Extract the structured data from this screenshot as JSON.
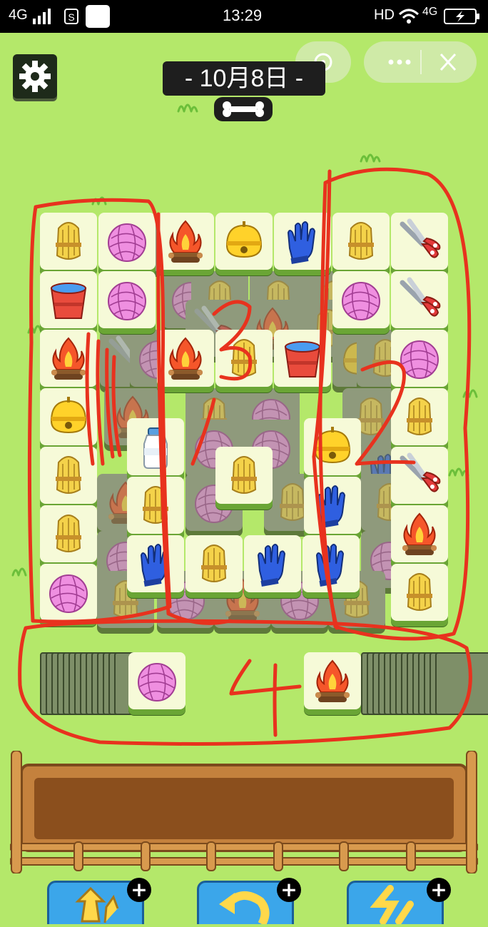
{
  "status_bar": {
    "network_left": "4G",
    "time": "13:29",
    "hd": "HD",
    "network_right": "4G"
  },
  "header": {
    "date": "- 10月8日 -"
  },
  "annotations": {
    "label_1": "1",
    "label_2a": "2",
    "label_3": "3",
    "label_2b": "2",
    "label_4": "4"
  },
  "board": {
    "top_layer": [
      {
        "icon": "wheat-icon"
      },
      {
        "icon": "yarn-icon"
      },
      {
        "icon": "campfire-icon"
      },
      {
        "icon": "bell-icon"
      },
      {
        "icon": "glove-icon"
      },
      {
        "icon": "wheat-icon"
      },
      {
        "icon": "scissors-icon"
      },
      {
        "icon": "bucket-icon"
      },
      {
        "icon": "yarn-icon"
      },
      {
        "icon": "yarn-icon"
      },
      {
        "icon": "scissors-icon"
      },
      {
        "icon": "campfire-icon"
      },
      {
        "icon": "campfire-icon"
      },
      {
        "icon": "wheat-icon"
      },
      {
        "icon": "bucket-icon"
      },
      {
        "icon": "yarn-icon"
      },
      {
        "icon": "bell-icon"
      },
      {
        "icon": "wheat-icon"
      },
      {
        "icon": "wheat-icon"
      },
      {
        "icon": "milk-bottle-icon"
      },
      {
        "icon": "wheat-icon"
      },
      {
        "icon": "bell-icon"
      },
      {
        "icon": "scissors-icon"
      },
      {
        "icon": "wheat-icon"
      },
      {
        "icon": "wheat-icon"
      },
      {
        "icon": "glove-icon"
      },
      {
        "icon": "campfire-icon"
      },
      {
        "icon": "yarn-icon"
      },
      {
        "icon": "glove-icon"
      },
      {
        "icon": "wheat-icon"
      },
      {
        "icon": "glove-icon"
      },
      {
        "icon": "glove-icon"
      },
      {
        "icon": "wheat-icon"
      }
    ],
    "stack_left_top": {
      "icon": "yarn-icon"
    },
    "stack_right_top": {
      "icon": "campfire-icon"
    }
  },
  "buttons": [
    {
      "name": "shuffle-button",
      "icon": "shuffle-icon"
    },
    {
      "name": "undo-button",
      "icon": "undo-icon"
    },
    {
      "name": "remove-button",
      "icon": "scatter-icon"
    }
  ],
  "colors": {
    "background": "#b4e86a",
    "tile_face": "#f6fad8",
    "tile_edge": "#6aa535",
    "annotation_red": "#e8321e",
    "button_blue": "#3ba6ea"
  }
}
